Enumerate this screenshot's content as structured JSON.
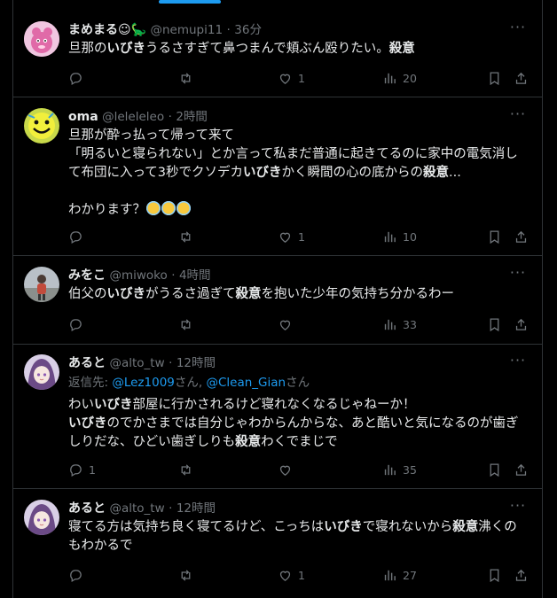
{
  "colors": {
    "background": "#000000",
    "text": "#e7e9ea",
    "muted": "#71767b",
    "accent": "#1d9bf0",
    "divider": "#2f3336"
  },
  "tweets": [
    {
      "name": "まめまる☺🦕",
      "handle": "@nemupi11",
      "sep": "·",
      "time": "36分",
      "text_segments": [
        {
          "t": "旦那の",
          "b": false
        },
        {
          "t": "いびき",
          "b": true
        },
        {
          "t": "うるさすぎて鼻つまんで頬ぶん殴りたい。",
          "b": false
        },
        {
          "t": "殺意",
          "b": true
        }
      ],
      "stats": {
        "reply": "",
        "retweet": "",
        "like": "1",
        "views": "20"
      }
    },
    {
      "name": "oma",
      "handle": "@leleleleo",
      "sep": "·",
      "time": "2時間",
      "text_segments": [
        {
          "t": "旦那が酔っ払って帰って来て\n「明るいと寝られない」とか言って私まだ普通に起きてるのに家中の電気消して布団に入って3秒でクソデカ",
          "b": false
        },
        {
          "t": "いびき",
          "b": true
        },
        {
          "t": "かく瞬間の心の底からの",
          "b": false
        },
        {
          "t": "殺意",
          "b": true
        },
        {
          "t": "...\n\nわかります？",
          "b": false
        }
      ],
      "emoji_suffix": [
        "smiling-face-with-halo-emoji",
        "smiling-face-with-halo-emoji",
        "smiling-face-with-halo-emoji"
      ],
      "stats": {
        "reply": "",
        "retweet": "",
        "like": "1",
        "views": "10"
      }
    },
    {
      "name": "みをこ",
      "handle": "@miwoko",
      "sep": "·",
      "time": "4時間",
      "text_segments": [
        {
          "t": "伯父の",
          "b": false
        },
        {
          "t": "いびき",
          "b": true
        },
        {
          "t": "がうるさ過ぎて",
          "b": false
        },
        {
          "t": "殺意",
          "b": true
        },
        {
          "t": "を抱いた少年の気持ち分かるわー",
          "b": false
        }
      ],
      "stats": {
        "reply": "",
        "retweet": "",
        "like": "",
        "views": "33"
      }
    },
    {
      "name": "あると",
      "handle": "@alto_tw",
      "sep": "·",
      "time": "12時間",
      "reply_to": {
        "prefix": "返信先: ",
        "mention1": "@Lez1009",
        "middle": "さん, ",
        "mention2": "@Clean_Gian",
        "suffix": "さん"
      },
      "text_segments": [
        {
          "t": "わい",
          "b": false
        },
        {
          "t": "いびき",
          "b": true
        },
        {
          "t": "部屋に行かされるけど寝れなくなるじゃねーか！\n",
          "b": false
        },
        {
          "t": "いびき",
          "b": true
        },
        {
          "t": "のでかさまでは自分じゃわからんからな、あと酷いと気になるのが歯ぎしりだな、ひどい歯ぎしりも",
          "b": false
        },
        {
          "t": "殺意",
          "b": true
        },
        {
          "t": "わくでまじで",
          "b": false
        }
      ],
      "stats": {
        "reply": "1",
        "retweet": "",
        "like": "",
        "views": "35"
      }
    },
    {
      "name": "あると",
      "handle": "@alto_tw",
      "sep": "·",
      "time": "12時間",
      "text_segments": [
        {
          "t": "寝てる方は気持ち良く寝てるけど、こっちは",
          "b": false
        },
        {
          "t": "いびき",
          "b": true
        },
        {
          "t": "で寝れないから",
          "b": false
        },
        {
          "t": "殺意",
          "b": true
        },
        {
          "t": "沸くのもわかるで",
          "b": false
        }
      ],
      "stats": {
        "reply": "",
        "retweet": "",
        "like": "1",
        "views": "27"
      }
    }
  ]
}
